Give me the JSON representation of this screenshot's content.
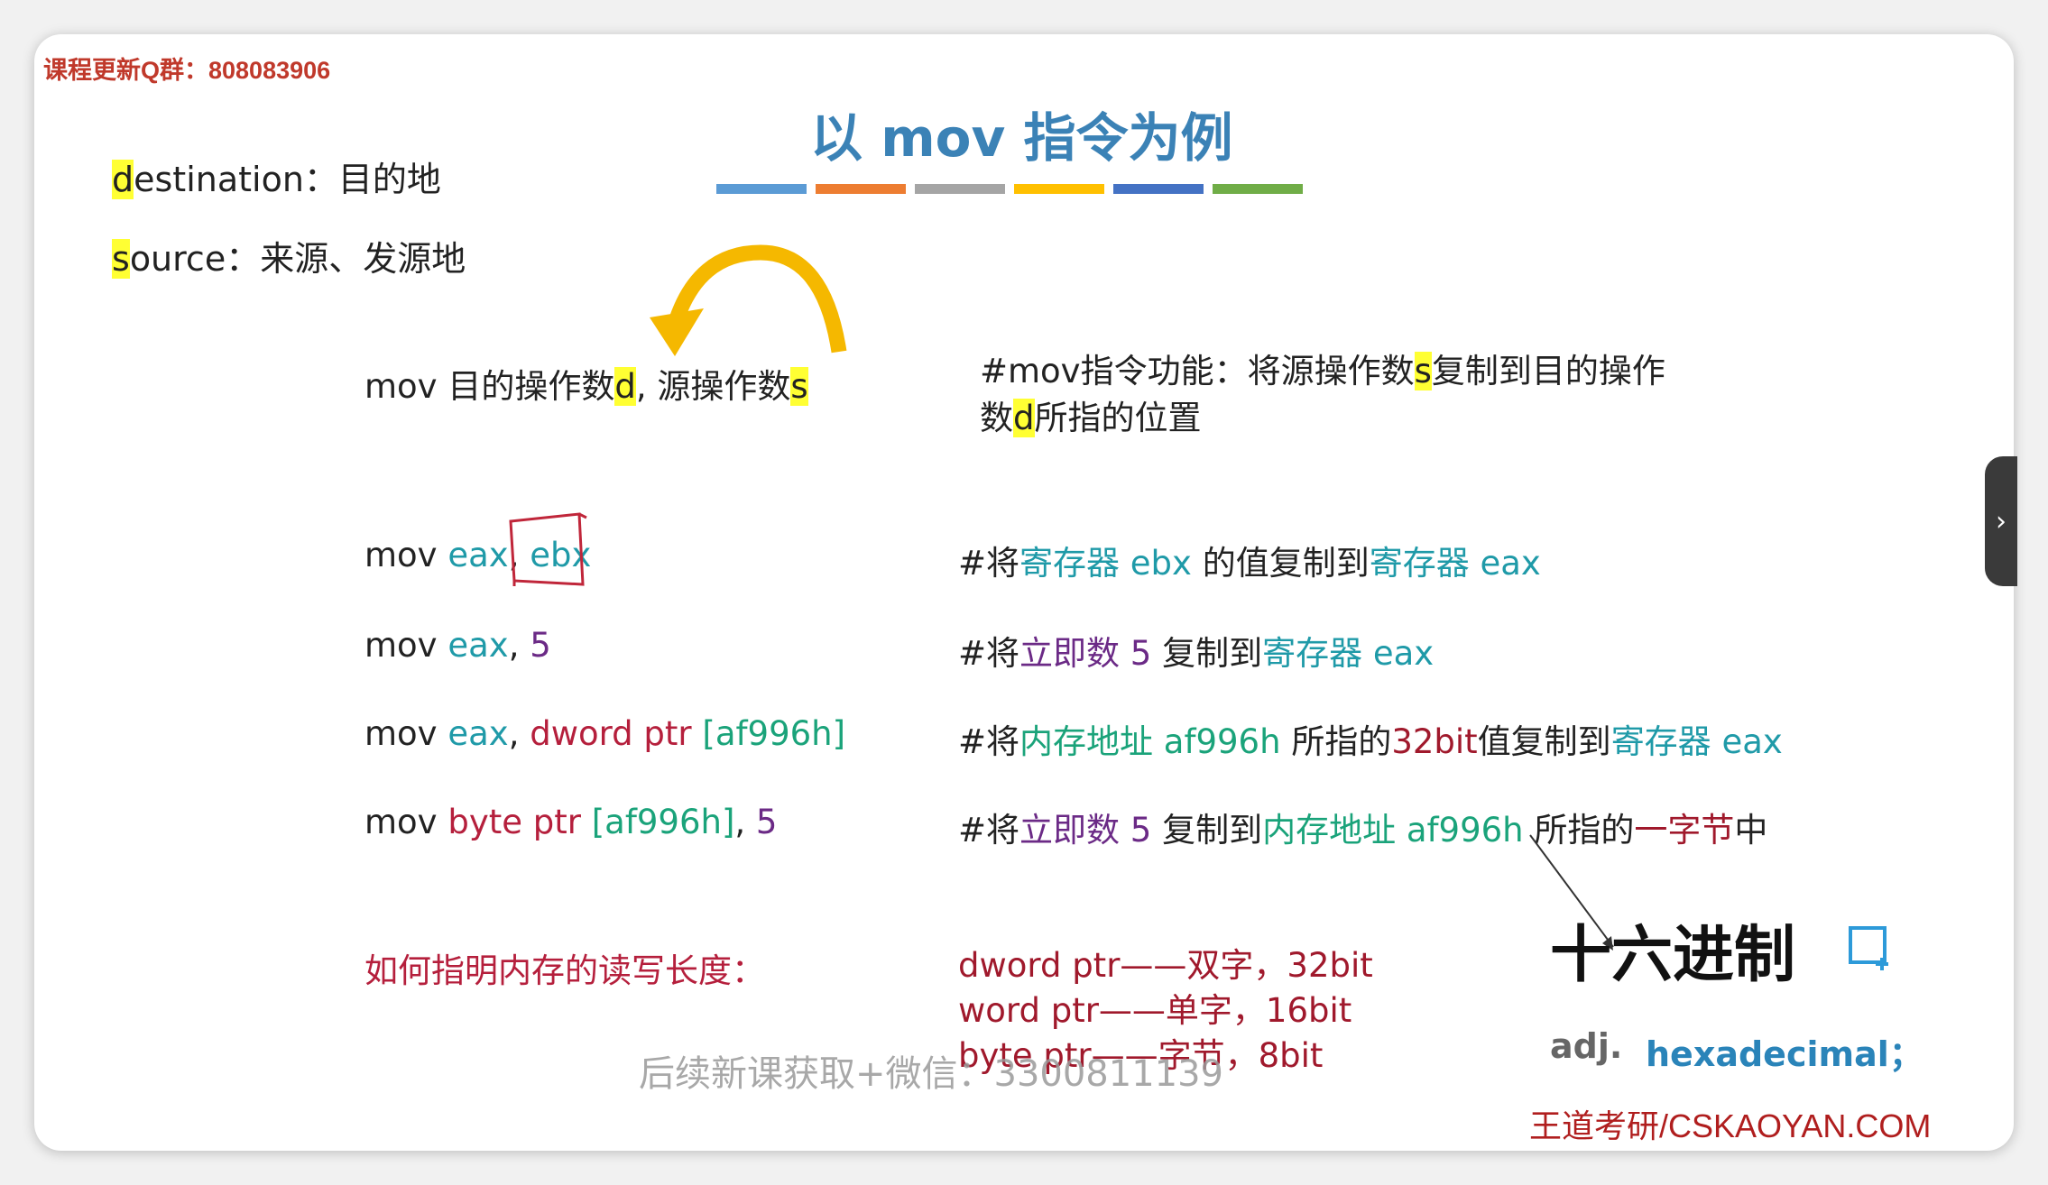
{
  "header": {
    "qq_group": "课程更新Q群：808083906"
  },
  "definitions": [
    {
      "first_letter": "d",
      "rest": "estination：",
      "meaning": "目的地"
    },
    {
      "first_letter": "s",
      "rest": "ource：",
      "meaning": "来源、发源地"
    }
  ],
  "title": "以 mov 指令为例",
  "color_bars": [
    "#5b9bd5",
    "#ed7d31",
    "#a5a5a5",
    "#ffc000",
    "#4472c4",
    "#70ad47"
  ],
  "syntax": {
    "prefix": "mov 目的操作数",
    "d": "d",
    "mid": ", 源操作数",
    "s": "s"
  },
  "function_note": {
    "line1_a": "#mov指令功能：将源操作数",
    "line1_s": "s",
    "line1_b": "复制到目的操作",
    "line2_a": "数",
    "line2_d": "d",
    "line2_b": "所指的位置"
  },
  "examples": [
    {
      "code": {
        "mov": "mov ",
        "dst": "eax",
        "comma": ", ",
        "src": "ebx"
      },
      "note": {
        "a": "#将",
        "b": "寄存器 ebx",
        "c": " 的值复制到",
        "d": "寄存器 eax"
      }
    },
    {
      "code": {
        "mov": "mov ",
        "dst": "eax",
        "comma": ", ",
        "src": "5"
      },
      "note": {
        "a": "#将",
        "b": "立即数 5",
        "c": " 复制到",
        "d": "寄存器 eax"
      }
    },
    {
      "code": {
        "mov": "mov ",
        "dst": "eax",
        "comma": ", ",
        "ptr": "dword ptr ",
        "addr": "[af996h]"
      },
      "note": {
        "a": "#将",
        "b": "内存地址 af996h",
        "c": " 所指的",
        "bits": "32bit",
        "c2": "值复制到",
        "d": "寄存器 eax"
      }
    },
    {
      "code": {
        "mov": "mov ",
        "ptr": "byte ptr ",
        "addr": "[af996h]",
        "comma": ", ",
        "src": "5"
      },
      "note": {
        "a": "#将",
        "b": "立即数 5",
        "c": " 复制到",
        "d": "内存地址 af996h",
        "e": " 所指的",
        "f": "一字节",
        "g": "中"
      }
    }
  ],
  "length_question": "如何指明内存的读写长度：",
  "lengths": [
    "dword ptr——双字，32bit",
    "word ptr——单字，16bit",
    "byte ptr——字节，8bit"
  ],
  "hex_card": {
    "word": "十六进制",
    "pos": "adj.",
    "english": "hexadecimal；"
  },
  "watermark": "后续新课获取+微信：3300811139",
  "brand": "王道考研/CSKAOYAN.COM",
  "colors": {
    "title": "#3b82b6",
    "highlight": "#ffff33",
    "arrow": "#f5b800"
  },
  "icons": {
    "expand": "chevron-right-icon",
    "add_note": "add-note-icon"
  }
}
